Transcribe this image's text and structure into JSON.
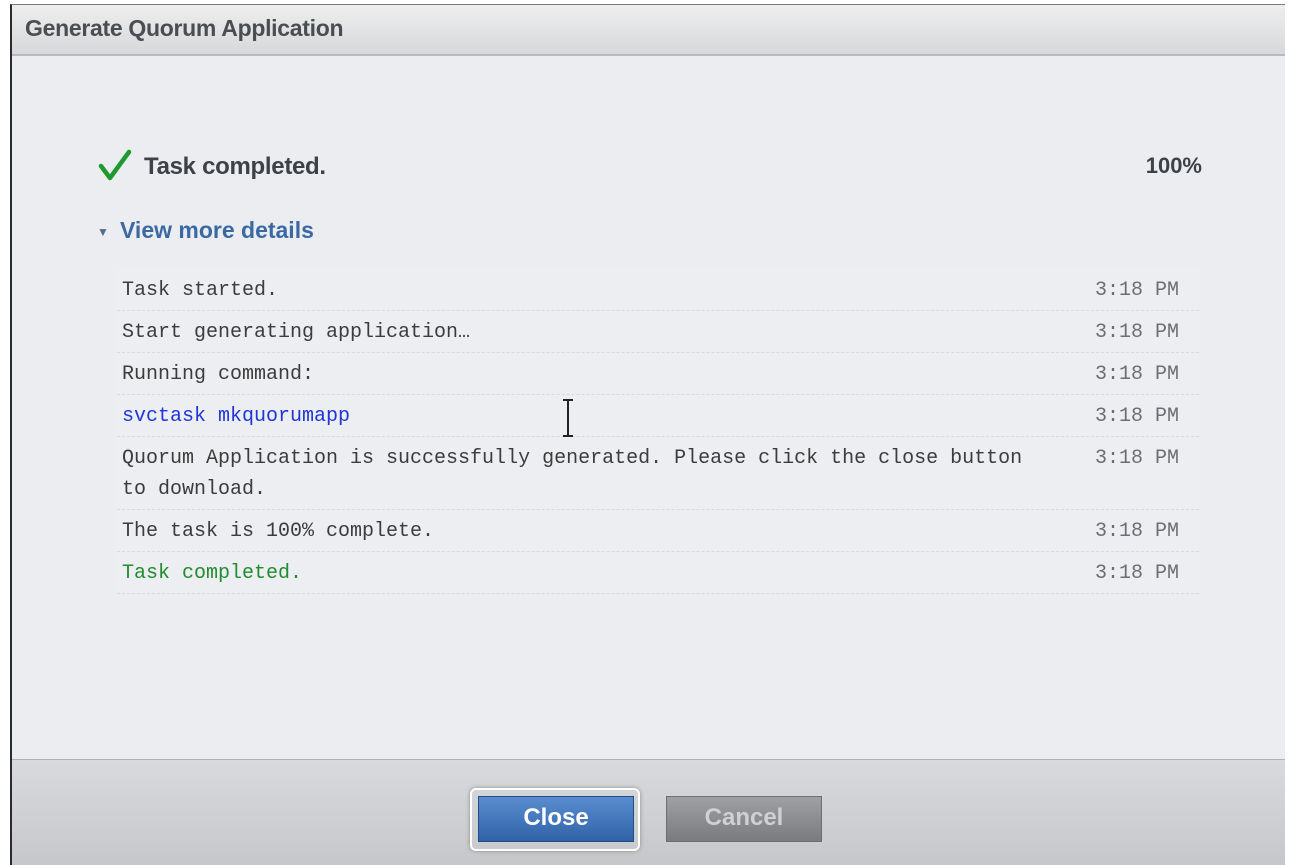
{
  "window": {
    "title": "Generate Quorum Application"
  },
  "status": {
    "text": "Task completed.",
    "percent": "100%",
    "progress_fraction": 1.0,
    "icon": "checkmark-icon",
    "icon_color": "#1e9a2e"
  },
  "details": {
    "toggle_label": "View more details",
    "expanded": true,
    "log": [
      {
        "message": "Task started.",
        "time": "3:18 PM",
        "style": "normal"
      },
      {
        "message": "Start generating application…",
        "time": "3:18 PM",
        "style": "normal"
      },
      {
        "message": "Running command:",
        "time": "3:18 PM",
        "style": "normal"
      },
      {
        "message": "svctask mkquorumapp",
        "time": "3:18 PM",
        "style": "command"
      },
      {
        "message": "Quorum Application is successfully generated. Please click the close button to download.",
        "time": "3:18 PM",
        "style": "normal"
      },
      {
        "message": "The task is 100% complete.",
        "time": "3:18 PM",
        "style": "normal"
      },
      {
        "message": "Task completed.",
        "time": "3:18 PM",
        "style": "success"
      }
    ]
  },
  "footer": {
    "close_label": "Close",
    "cancel_label": "Cancel",
    "cancel_enabled": false
  },
  "colors": {
    "command_text": "#1f35d8",
    "success_text": "#218c2f",
    "primary_button": "#3a6fb5"
  }
}
